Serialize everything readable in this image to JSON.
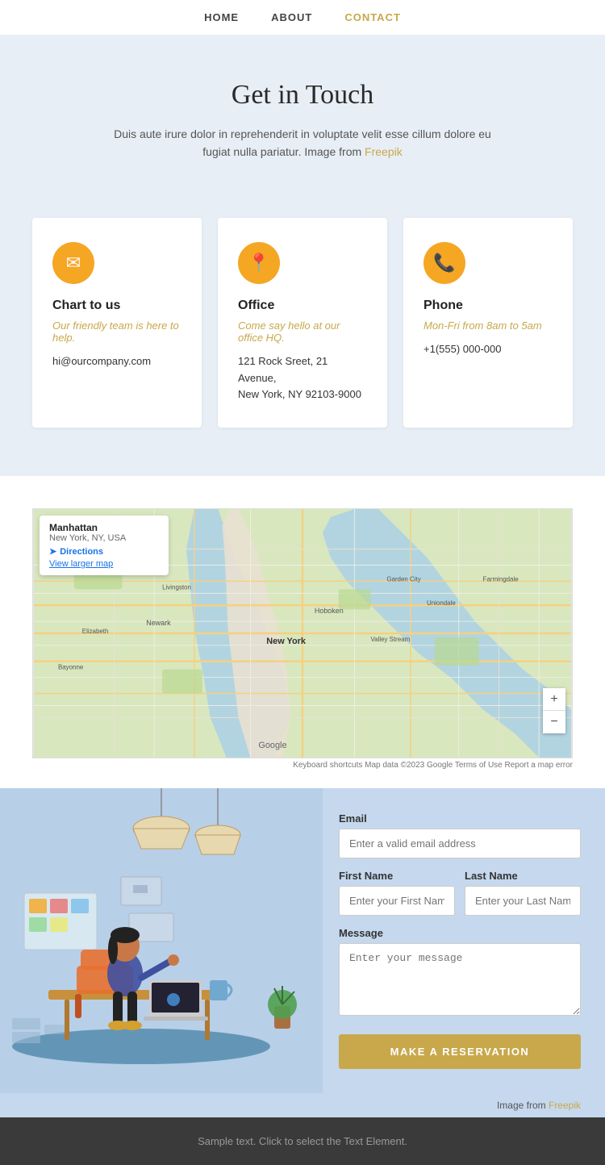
{
  "nav": {
    "items": [
      {
        "label": "HOME",
        "active": false
      },
      {
        "label": "ABOUT",
        "active": false
      },
      {
        "label": "CONTACT",
        "active": true
      }
    ]
  },
  "hero": {
    "title": "Get in Touch",
    "body": "Duis aute irure dolor in reprehenderit in voluptate velit esse cillum dolore eu fugiat nulla pariatur. Image from",
    "link_text": "Freepik",
    "link_url": "#"
  },
  "cards": [
    {
      "icon": "✉",
      "title": "Chart to us",
      "subtitle": "Our friendly team is here to help.",
      "detail": "hi@ourcompany.com"
    },
    {
      "icon": "📍",
      "title": "Office",
      "subtitle": "Come say hello at our office HQ.",
      "detail": "121 Rock Sreet, 21 Avenue,\nNew York, NY 92103-9000"
    },
    {
      "icon": "📞",
      "title": "Phone",
      "subtitle": "Mon-Fri from 8am to 5am",
      "detail": "+1(555) 000-000"
    }
  ],
  "map": {
    "place_name": "Manhattan",
    "place_sub": "New York, NY, USA",
    "directions_label": "Directions",
    "view_map": "View larger map",
    "zoom_in": "+",
    "zoom_out": "−",
    "footer_text": "Keyboard shortcuts  Map data ©2023 Google  Terms of Use  Report a map error"
  },
  "form": {
    "email_label": "Email",
    "email_placeholder": "Enter a valid email address",
    "firstname_label": "First Name",
    "firstname_placeholder": "Enter your First Name",
    "lastname_label": "Last Name",
    "lastname_placeholder": "Enter your Last Name",
    "message_label": "Message",
    "message_placeholder": "Enter your message",
    "submit_label": "MAKE A RESERVATION"
  },
  "image_credit": {
    "text": "Image from",
    "link": "Freepik"
  },
  "footer": {
    "text": "Sample text. Click to select the Text Element."
  }
}
